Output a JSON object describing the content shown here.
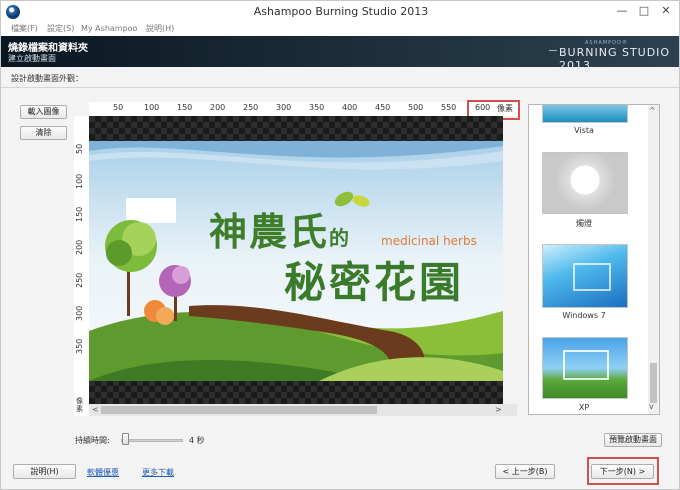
{
  "window": {
    "title": "Ashampoo Burning Studio 2013",
    "controls": {
      "minimize": "—",
      "maximize": "□",
      "close": "✕"
    }
  },
  "menu": [
    {
      "label": "檔案(F)"
    },
    {
      "label": "設定(S)"
    },
    {
      "label": "My Ashampoo"
    },
    {
      "label": "說明(H)"
    }
  ],
  "header": {
    "title": "燒錄檔案和資料夾",
    "subtitle": "建立啟動畫面",
    "logo_small": "ASHAMPOO®",
    "logo": "BURNING STUDIO 2013"
  },
  "section_label": "設計啟動畫面外觀：",
  "left_buttons": {
    "load_image": "載入圖像",
    "clear": "清除"
  },
  "ruler": {
    "top_ticks": [
      "50",
      "100",
      "150",
      "200",
      "250",
      "300",
      "350",
      "400",
      "450",
      "500",
      "550",
      "600"
    ],
    "top_unit": "像素",
    "left_ticks": [
      "50",
      "100",
      "150",
      "200",
      "250",
      "300",
      "350"
    ],
    "left_unit": "像素"
  },
  "splash": {
    "title_line1": "神農氏",
    "title_de": "的",
    "subtitle_en": "medicinal herbs",
    "title_line2": "秘密花園"
  },
  "canvas_scroll": {
    "left_arrow": "<",
    "right_arrow": ">"
  },
  "templates": [
    {
      "label": "Vista"
    },
    {
      "label": "燭燈"
    },
    {
      "label": "Windows 7"
    },
    {
      "label": "XP"
    }
  ],
  "panel_scroll": {
    "up_arrow": "^",
    "down_arrow": "v"
  },
  "duration": {
    "label": "持續時間:",
    "value": "4 秒"
  },
  "preview_button": "預覽啟動畫面",
  "footer": {
    "help_button": "說明(H)",
    "link_software_deals": "軟體優惠",
    "link_more_downloads": "更多下載",
    "back_button": "< 上一步(B)",
    "next_button": "下一步(N) >"
  },
  "colors": {
    "banner_bg": "#0a1620",
    "highlight_red": "#d0504f",
    "link_blue": "#1f5fb0",
    "splash_green": "#3f7d2b",
    "splash_orange": "#e07a3a"
  }
}
